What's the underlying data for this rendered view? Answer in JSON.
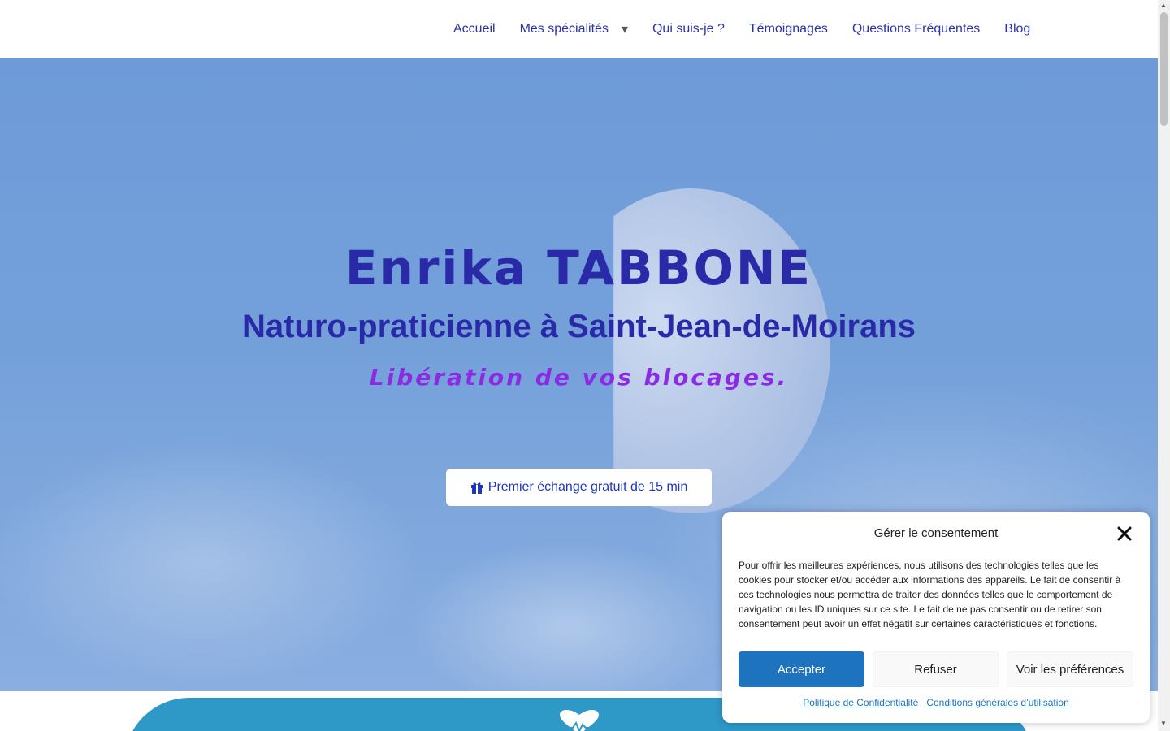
{
  "nav": {
    "items": [
      {
        "label": "Accueil"
      },
      {
        "label": "Mes spécialités",
        "has_dropdown": true
      },
      {
        "label": "Qui suis-je ?"
      },
      {
        "label": "Témoignages"
      },
      {
        "label": "Questions Fréquentes"
      },
      {
        "label": "Blog"
      }
    ],
    "caret": "▾"
  },
  "hero": {
    "title": "Enrika TABBONE",
    "subtitle": "Naturo-praticienne à Saint-Jean-de-Moirans",
    "tagline": "Libération de vos blocages.",
    "cta_label": "Premier échange gratuit de 15 min",
    "cta_icon": "gift-icon"
  },
  "consent": {
    "title": "Gérer le consentement",
    "body": "Pour offrir les meilleures expériences, nous utilisons des technologies telles que les cookies pour stocker et/ou accéder aux informations des appareils. Le fait de consentir à ces technologies nous permettra de traiter des données telles que le comportement de navigation ou les ID uniques sur ce site. Le fait de ne pas consentir ou de retirer son consentement peut avoir un effet négatif sur certaines caractéristiques et fonctions.",
    "accept_label": "Accepter",
    "refuse_label": "Refuser",
    "prefs_label": "Voir les préférences",
    "privacy_link": "Politique de Confidentialité",
    "terms_link": "Conditions générales d’utilisation"
  },
  "colors": {
    "nav_text": "#2b33a6",
    "hero_title": "#2a2aa8",
    "tagline": "#8a2be2",
    "accept_bg": "#1e73be",
    "band": "#2e98c7"
  }
}
